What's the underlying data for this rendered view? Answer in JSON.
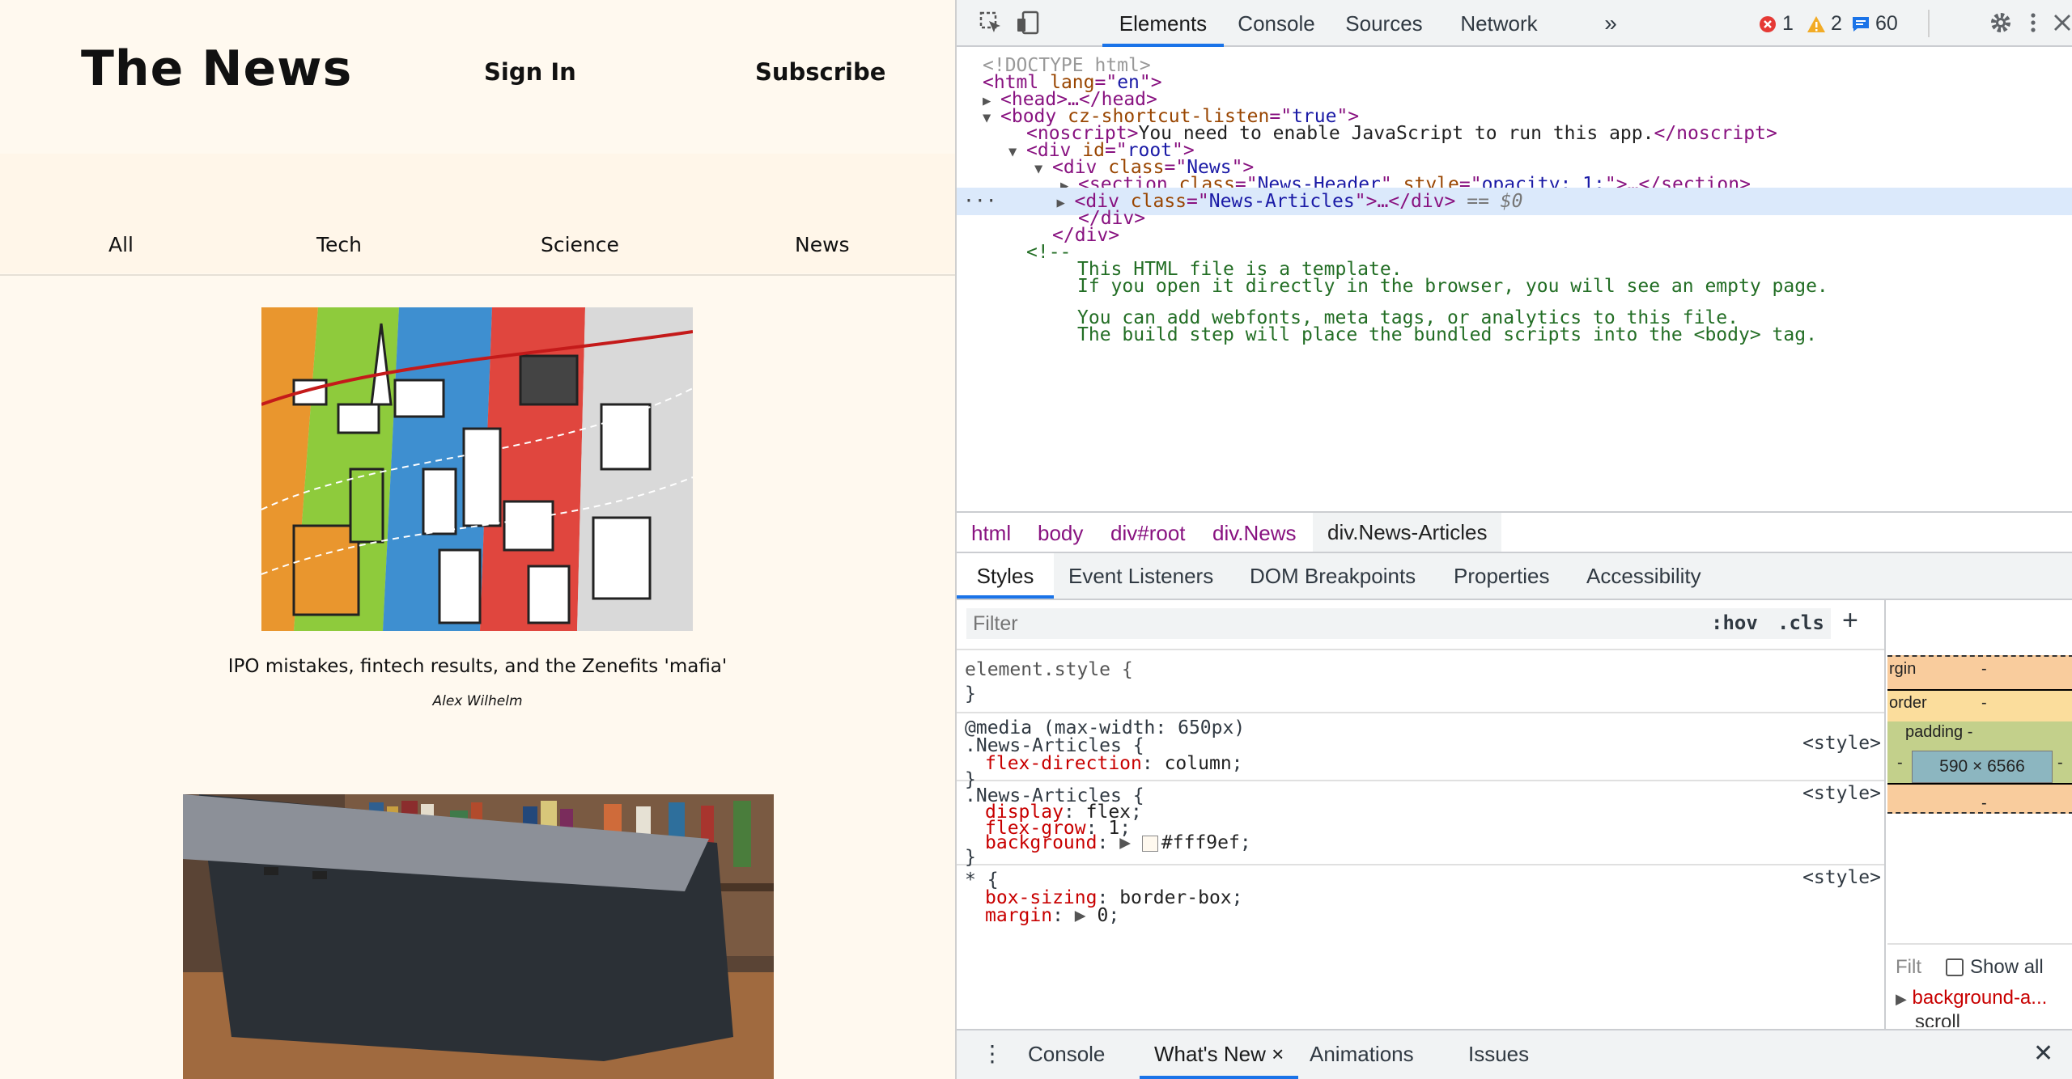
{
  "page": {
    "brand": "The News",
    "sign_in": "Sign In",
    "subscribe": "Subscribe",
    "categories": [
      "All",
      "Tech",
      "Science",
      "News"
    ],
    "articles": [
      {
        "title": "IPO mistakes, fintech results, and the Zenefits 'mafia'",
        "author": "Alex Wilhelm"
      }
    ]
  },
  "devtools": {
    "tabs": [
      "Elements",
      "Console",
      "Sources",
      "Network"
    ],
    "more": "»",
    "counts": {
      "errors": "1",
      "warnings": "2",
      "messages": "60"
    },
    "dom": {
      "l0": "<!DOCTYPE html>",
      "l1_tag": "<html",
      "l1_att": " lang",
      "l1_eq": "=\"",
      "l1_val": "en",
      "l1_end": "\">",
      "l2": "<head>…</head>",
      "l3_tag": "<body",
      "l3_att": " cz-shortcut-listen",
      "l3_val": "true",
      "l4_open": "<noscript>",
      "l4_text": "You need to enable JavaScript to run this app.",
      "l4_close": "</noscript>",
      "l5_tag": "<div",
      "l5_att": " id",
      "l5_val": "root",
      "l6_tag": "<div",
      "l6_att": " class",
      "l6_val": "News",
      "l7_tag": "<section",
      "l7_att1": " class",
      "l7_val1": "News-Header",
      "l7_att2": " style",
      "l7_val2": "opacity: 1;",
      "l7_end": ">…</section>",
      "l8_tag": "<div",
      "l8_att": " class",
      "l8_val": "News-Articles",
      "l8_end": ">…</div>",
      "l8_sel": " == $0",
      "l9": "</div>",
      "l10": "</div>",
      "l11": "<!--",
      "c1": "This HTML file is a template.",
      "c2": "If you open it directly in the browser, you will see an empty page.",
      "c3": "You can add webfonts, meta tags, or analytics to this file.",
      "c4": "The build step will place the bundled scripts into the <body> tag."
    },
    "breadcrumbs": [
      "html",
      "body",
      "div#root",
      "div.News",
      "div.News-Articles"
    ],
    "subtabs": [
      "Styles",
      "Event Listeners",
      "DOM Breakpoints",
      "Properties",
      "Accessibility"
    ],
    "styles": {
      "filter_placeholder": "Filter",
      "hov": ":hov",
      "cls": ".cls",
      "plus": "+",
      "element_style": "element.style {",
      "close": "}",
      "media": "@media (max-width: 650px)",
      "sel_articles": ".News-Articles {",
      "source": "<style>",
      "prop_flex_direction": "flex-direction",
      "val_column": "column",
      "prop_display": "display",
      "val_flex": "flex",
      "prop_flex_grow": "flex-grow",
      "val_1": "1",
      "prop_background": "background",
      "val_bg": "#fff9ef",
      "sel_star": "* {",
      "prop_box_sizing": "box-sizing",
      "val_border_box": "border-box",
      "prop_margin": "margin",
      "val_margin": "0",
      "bg_color": "#fff9ef"
    },
    "boxmodel": {
      "margin": "rgin",
      "border": "order",
      "padding": "padding -",
      "dash": "-",
      "content": "590 × 6566"
    },
    "computed": {
      "filter": "Filt",
      "show_all": "Show all",
      "prop": "background-a...",
      "next": "scroll"
    },
    "drawer": {
      "console": "Console",
      "whats_new": "What's New",
      "close_tab": "×",
      "animations": "Animations",
      "issues": "Issues",
      "close": "✕"
    }
  }
}
